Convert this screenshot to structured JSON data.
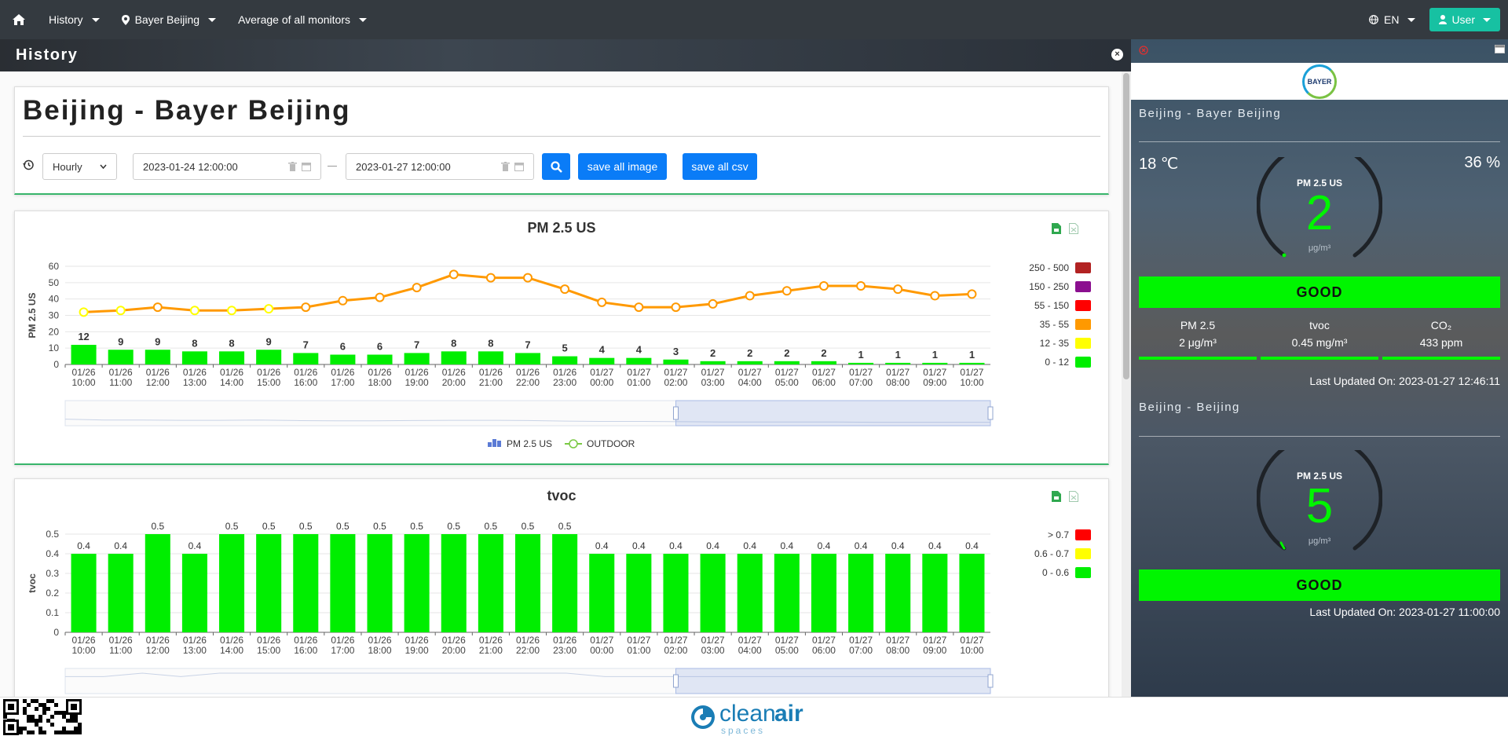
{
  "topbar": {
    "history_label": "History",
    "location_label": "Bayer Beijing",
    "monitor_label": "Average of all monitors",
    "lang_label": "EN",
    "user_label": "User"
  },
  "history_header": {
    "title": "History"
  },
  "filters": {
    "page_title": "Beijing - Bayer Beijing",
    "interval": "Hourly",
    "start_date": "2023-01-24 12:00:00",
    "end_date": "2023-01-27 12:00:00",
    "save_image_label": "save all image",
    "save_csv_label": "save all csv"
  },
  "chart_data": [
    {
      "type": "bar",
      "title": "PM 2.5 US",
      "ylabel": "PM 2.5 US",
      "ylim": [
        0,
        60
      ],
      "yticks": [
        "0",
        "10",
        "20",
        "30",
        "40",
        "50",
        "60"
      ],
      "categories": [
        "01/26\n10:00",
        "01/26\n11:00",
        "01/26\n12:00",
        "01/26\n13:00",
        "01/26\n14:00",
        "01/26\n15:00",
        "01/26\n16:00",
        "01/26\n17:00",
        "01/26\n18:00",
        "01/26\n19:00",
        "01/26\n20:00",
        "01/26\n21:00",
        "01/26\n22:00",
        "01/26\n23:00",
        "01/27\n00:00",
        "01/27\n01:00",
        "01/27\n02:00",
        "01/27\n03:00",
        "01/27\n04:00",
        "01/27\n05:00",
        "01/27\n06:00",
        "01/27\n07:00",
        "01/27\n08:00",
        "01/27\n09:00",
        "01/27\n10:00"
      ],
      "series": [
        {
          "name": "PM 2.5 US",
          "kind": "bar",
          "values": [
            12,
            9,
            9,
            8,
            8,
            9,
            7,
            6,
            6,
            7,
            8,
            8,
            7,
            5,
            4,
            4,
            3,
            2,
            2,
            2,
            2,
            1,
            1,
            1,
            1
          ]
        },
        {
          "name": "OUTDOOR",
          "kind": "line",
          "values": [
            32,
            33,
            35,
            33,
            33,
            34,
            35,
            39,
            41,
            47,
            55,
            53,
            53,
            46,
            38,
            35,
            35,
            37,
            42,
            45,
            48,
            48,
            46,
            42,
            43
          ]
        }
      ],
      "legend": [
        {
          "label": "250 - 500",
          "color": "#b22222"
        },
        {
          "label": "150 - 250",
          "color": "#8b0f8f"
        },
        {
          "label": "55 - 150",
          "color": "#ff0000"
        },
        {
          "label": "35 - 55",
          "color": "#ff9900"
        },
        {
          "label": "12 - 35",
          "color": "#ffff00"
        },
        {
          "label": "0 - 12",
          "color": "#00ee00"
        }
      ],
      "grid": true
    },
    {
      "type": "bar",
      "title": "tvoc",
      "ylabel": "tvoc",
      "ylim": [
        0,
        0.5
      ],
      "yticks": [
        "0",
        "0.1",
        "0.2",
        "0.3",
        "0.4",
        "0.5"
      ],
      "categories": [
        "01/26\n10:00",
        "01/26\n11:00",
        "01/26\n12:00",
        "01/26\n13:00",
        "01/26\n14:00",
        "01/26\n15:00",
        "01/26\n16:00",
        "01/26\n17:00",
        "01/26\n18:00",
        "01/26\n19:00",
        "01/26\n20:00",
        "01/26\n21:00",
        "01/26\n22:00",
        "01/26\n23:00",
        "01/27\n00:00",
        "01/27\n01:00",
        "01/27\n02:00",
        "01/27\n03:00",
        "01/27\n04:00",
        "01/27\n05:00",
        "01/27\n06:00",
        "01/27\n07:00",
        "01/27\n08:00",
        "01/27\n09:00",
        "01/27\n10:00"
      ],
      "series": [
        {
          "name": "tvoc",
          "kind": "bar",
          "values": [
            0.4,
            0.4,
            0.5,
            0.4,
            0.5,
            0.5,
            0.5,
            0.5,
            0.5,
            0.5,
            0.5,
            0.5,
            0.5,
            0.5,
            0.4,
            0.4,
            0.4,
            0.4,
            0.4,
            0.4,
            0.4,
            0.4,
            0.4,
            0.4,
            0.4
          ]
        }
      ],
      "legend": [
        {
          "label": "> 0.7",
          "color": "#ff0000"
        },
        {
          "label": "0.6 - 0.7",
          "color": "#ffff00"
        },
        {
          "label": "0 - 0.6",
          "color": "#00ee00"
        }
      ],
      "grid": true
    }
  ],
  "chart_legend": {
    "bar_label": "PM 2.5 US",
    "line_label": "OUTDOOR"
  },
  "side": {
    "monitor1": {
      "name": "Beijing - Bayer Beijing",
      "temperature": "18 ℃",
      "humidity": "36 %",
      "gauge_title": "PM 2.5 US",
      "gauge_value": "2",
      "gauge_unit": "μg/m³",
      "status": "GOOD",
      "metrics": [
        {
          "label": "PM 2.5",
          "value": "2 μg/m³"
        },
        {
          "label": "tvoc",
          "value": "0.45 mg/m³"
        },
        {
          "label": "CO₂",
          "value": "433 ppm"
        }
      ],
      "updated": "Last Updated On: 2023-01-27 12:46:11"
    },
    "monitor2": {
      "name": "Beijing - Beijing",
      "gauge_title": "PM 2.5 US",
      "gauge_value": "5",
      "gauge_unit": "μg/m³",
      "status": "GOOD",
      "updated": "Last Updated On: 2023-01-27 11:00:00"
    },
    "logo_text": "BAYER"
  },
  "footer": {
    "brand_clean": "clean",
    "brand_air": "air",
    "brand_sub": "spaces"
  },
  "colors": {
    "accent": "#0a7cf7",
    "good": "#00f500",
    "topbar": "#343a40",
    "user": "#17c1a2",
    "outdoor_line": "#ff9900",
    "outdoor_point": "#ffff00"
  }
}
